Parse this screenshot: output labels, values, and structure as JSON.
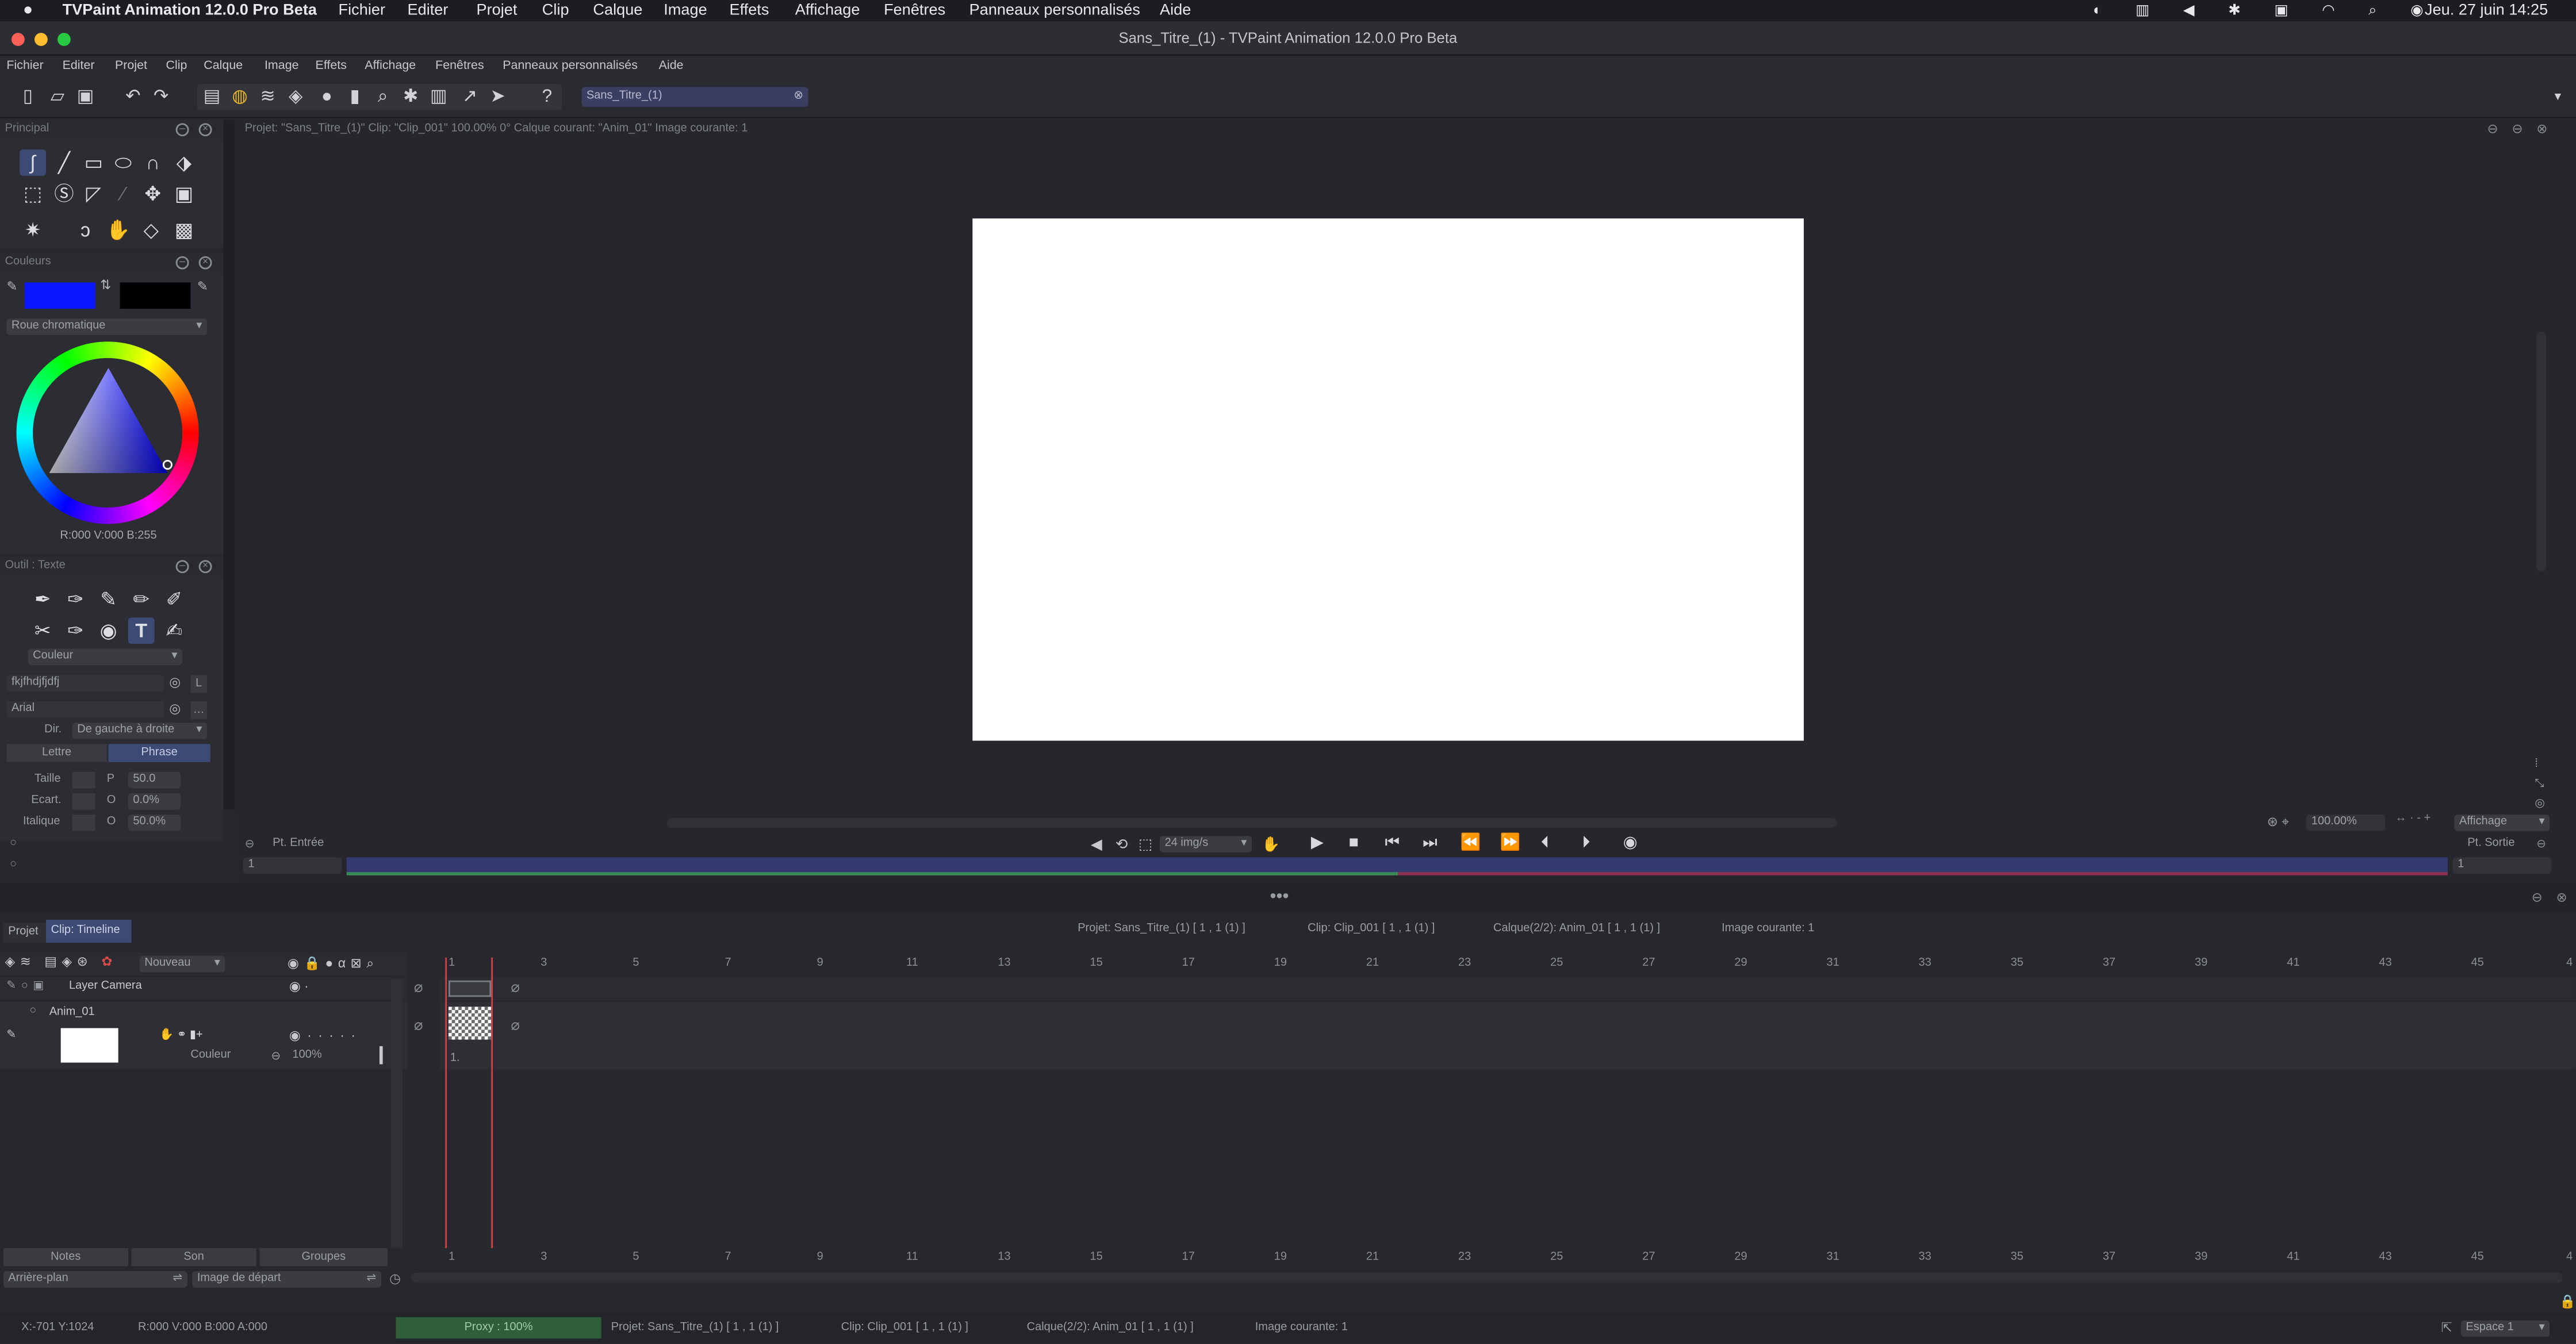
{
  "menubar": {
    "app": "TVPaint Animation 12.0.0 Pro Beta",
    "items": [
      "Fichier",
      "Editer",
      "Projet",
      "Clip",
      "Calque",
      "Image",
      "Effets",
      "Affichage",
      "Fenêtres",
      "Panneaux personnalisés",
      "Aide"
    ],
    "clock": "Jeu. 27 juin  14:25"
  },
  "window": {
    "title": "Sans_Titre_(1) - TVPaint Animation 12.0.0 Pro Beta"
  },
  "appmenu": [
    "Fichier",
    "Editer",
    "Projet",
    "Clip",
    "Calque",
    "Image",
    "Effets",
    "Affichage",
    "Fenêtres",
    "Panneaux personnalisés",
    "Aide"
  ],
  "toolbar": {
    "project_field": "Sans_Titre_(1)"
  },
  "panels": {
    "principal": "Principal",
    "couleurs": "Couleurs",
    "colors": {
      "primary": "#0a14ff",
      "secondary": "#000000"
    },
    "wheel_mode": "Roue chromatique",
    "rgb_readout": "R:000 V:000 B:255",
    "outil": "Outil : Texte",
    "couleur_select": "Couleur",
    "text_value": "fkjfhdjfjdfj",
    "text_L": "L",
    "font": "Arial",
    "dir_label": "Dir.",
    "dir_value": "De gauche à droite",
    "lettre": "Lettre",
    "phrase": "Phrase",
    "taille": "Taille",
    "taille_p": "P",
    "taille_val": "50.0",
    "ecart": "Ecart.",
    "ecart_p": "O",
    "ecart_val": "0.0%",
    "italique": "Italique",
    "italique_p": "O",
    "italique_val": "50.0%"
  },
  "canvas": {
    "info": "Projet: \"Sans_Titre_(1)\"  Clip: \"Clip_001\"  100.00%  0°  Calque courant: \"Anim_01\"  Image courante: 1",
    "pt_entree": "Pt. Entrée",
    "fps": "24 img/s",
    "zoom": "100.00%",
    "affichage": "Affichage",
    "pt_sortie": "Pt. Sortie",
    "in_frame": "1",
    "out_frame": "1"
  },
  "timeline": {
    "tab_projet": "Projet",
    "tab_clip": "Clip: Timeline",
    "info_projet": "Projet: Sans_Titre_(1) [ 1 , 1  (1) ]",
    "info_clip": "Clip: Clip_001 [ 1 , 1  (1) ]",
    "info_calque": "Calque(2/2): Anim_01 [ 1 , 1  (1) ]",
    "info_image": "Image courante: 1",
    "nouveau": "Nouveau",
    "layer_camera": "Layer Camera",
    "anim_layer": "Anim_01",
    "couleur": "Couleur",
    "opacity": "100%",
    "frame_label": "1.",
    "ticks": [
      "1",
      "3",
      "5",
      "7",
      "9",
      "11",
      "13",
      "15",
      "17",
      "19",
      "21",
      "23",
      "25",
      "27",
      "29",
      "31",
      "33",
      "35",
      "37",
      "39",
      "41",
      "43",
      "45",
      "4"
    ],
    "notes": "Notes",
    "son": "Son",
    "groupes": "Groupes",
    "arriere_plan": "Arrière-plan",
    "image_depart": "Image de départ"
  },
  "status": {
    "coords": "X:-701  Y:1024",
    "rgba": "R:000 V:000 B:000 A:000",
    "proxy": "Proxy : 100%",
    "projet": "Projet: Sans_Titre_(1) [ 1 , 1  (1) ]",
    "clip": "Clip: Clip_001 [ 1 , 1  (1) ]",
    "calque": "Calque(2/2): Anim_01 [ 1 , 1  (1) ]",
    "image": "Image courante: 1",
    "espace": "Espace 1"
  }
}
